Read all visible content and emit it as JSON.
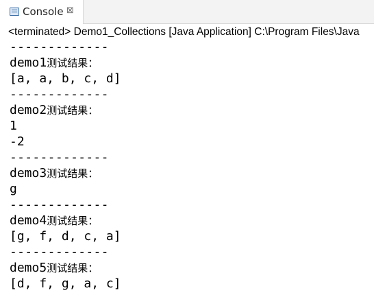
{
  "tab": {
    "title": "Console",
    "icon": "console-icon",
    "close_symbol": "⊠"
  },
  "status": {
    "text": "<terminated> Demo1_Collections [Java Application] C:\\Program Files\\Java"
  },
  "output": {
    "separator": "-------------",
    "lines": [
      "-------------",
      "demo1测试结果：",
      "[a, a, b, c, d]",
      "-------------",
      "demo2测试结果：",
      "1",
      "-2",
      "-------------",
      "demo3测试结果：",
      "g",
      "-------------",
      "demo4测试结果：",
      "[g, f, d, c, a]",
      "-------------",
      "demo5测试结果：",
      "[d, f, g, a, c]"
    ]
  },
  "colors": {
    "header_bg": "#f3f3f3",
    "tab_bg": "#ffffff",
    "icon_blue": "#3a6ea5",
    "text": "#000000"
  }
}
